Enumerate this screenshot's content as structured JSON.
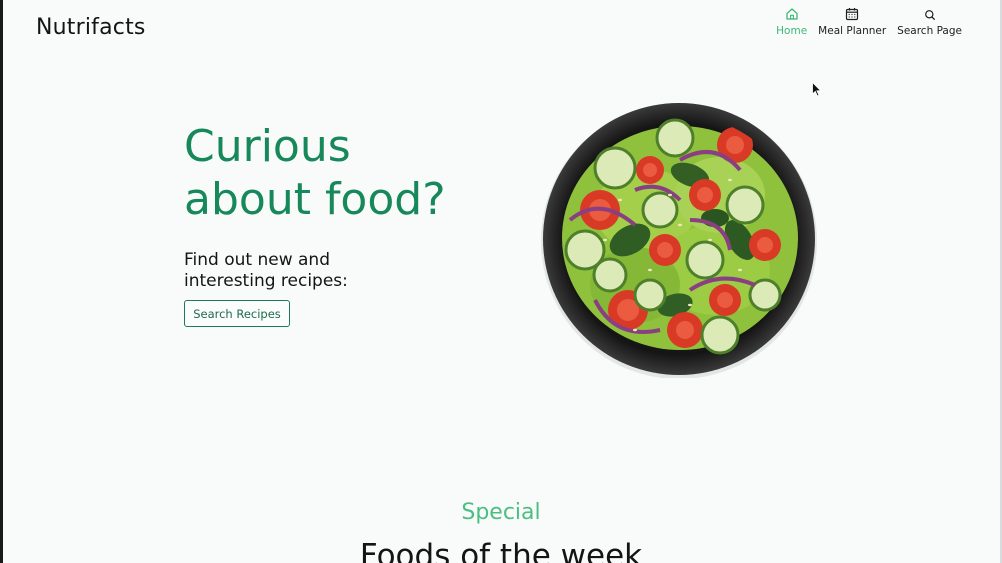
{
  "header": {
    "logo": "Nutrifacts",
    "nav": [
      {
        "label": "Home",
        "icon": "home-icon",
        "active": true
      },
      {
        "label": "Meal Planner",
        "icon": "calendar-icon",
        "active": false
      },
      {
        "label": "Search Page",
        "icon": "search-icon",
        "active": false
      }
    ]
  },
  "hero": {
    "title_line1": "Curious",
    "title_line2": "about food?",
    "subtitle_line1": "Find out new and",
    "subtitle_line2": "interesting recipes:",
    "button": "Search Recipes",
    "image": "salad-bowl"
  },
  "section": {
    "eyebrow": "Special",
    "heading": "Foods of the week"
  },
  "colors": {
    "accent": "#17885a",
    "accent_light": "#4bbf81",
    "background": "#f9fbfb"
  }
}
